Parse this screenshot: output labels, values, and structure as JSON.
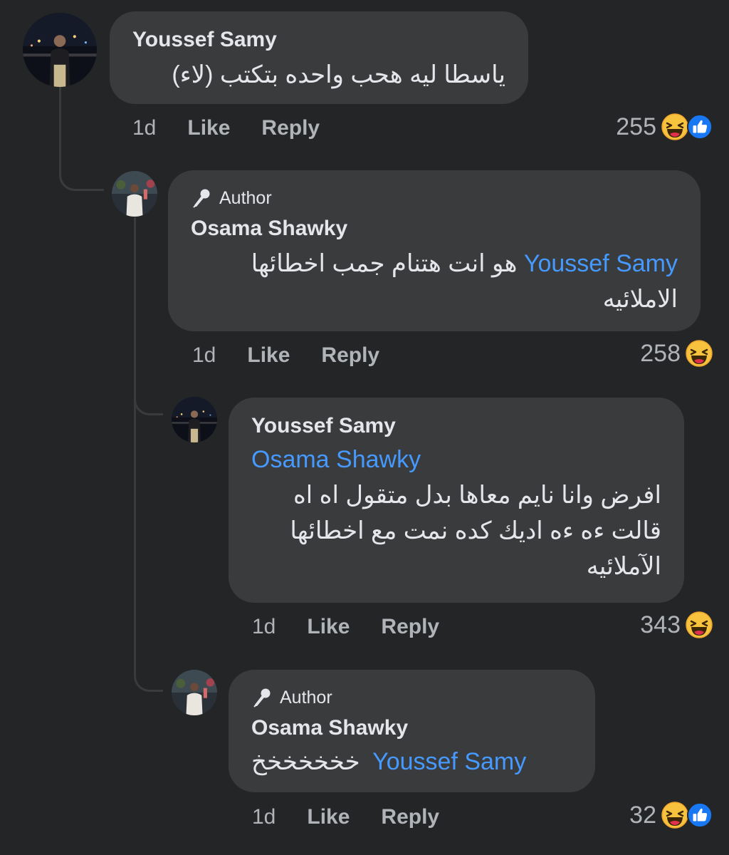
{
  "comments": [
    {
      "name": "Youssef Samy",
      "text": "ياسطا ليه هحب واحده بتكتب (لاء)",
      "time": "1d",
      "like_label": "Like",
      "reply_label": "Reply",
      "reaction_count": "255",
      "reactions": [
        "haha-icon",
        "like-icon"
      ]
    },
    {
      "badge": "Author",
      "name": "Osama Shawky",
      "mention": "Youssef Samy",
      "text_line1": "هو انت هتنام جمب اخطائها",
      "text_line2": "الاملائيه",
      "time": "1d",
      "like_label": "Like",
      "reply_label": "Reply",
      "reaction_count": "258",
      "reactions": [
        "haha-icon"
      ]
    },
    {
      "name": "Youssef Samy",
      "mention": "Osama Shawky",
      "text_line1": "افرض وانا نايم معاها بدل متقول اه اه",
      "text_line2": "قالت ءه ءه اديك كده نمت مع اخطائها",
      "text_line3": "الآملائيه",
      "time": "1d",
      "like_label": "Like",
      "reply_label": "Reply",
      "reaction_count": "343",
      "reactions": [
        "haha-icon"
      ]
    },
    {
      "badge": "Author",
      "name": "Osama Shawky",
      "mention": "Youssef Samy",
      "text": "خخخخخخخ",
      "time": "1d",
      "like_label": "Like",
      "reply_label": "Reply",
      "reaction_count": "32",
      "reactions": [
        "haha-icon",
        "like-icon"
      ]
    }
  ],
  "colors": {
    "background": "#242526",
    "bubble": "#3a3b3c",
    "text": "#e4e6eb",
    "secondary_text": "#b0b3b8",
    "mention": "#4599ff",
    "like_blue": "#1877f2",
    "haha_yellow": "#f7c23d"
  }
}
